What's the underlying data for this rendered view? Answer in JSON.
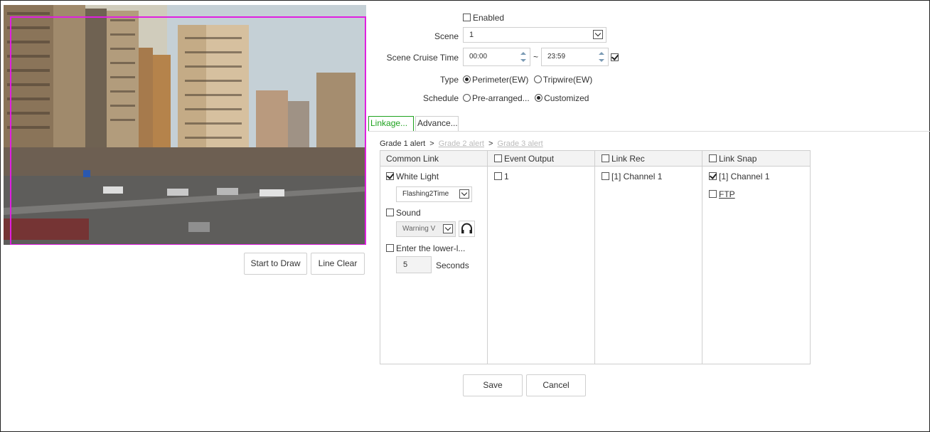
{
  "preview": {
    "start_draw_label": "Start to Draw",
    "line_clear_label": "Line Clear"
  },
  "form": {
    "enabled_label": "Enabled",
    "enabled_checked": false,
    "scene_label": "Scene",
    "scene_value": "1",
    "cruise_label": "Scene Cruise Time",
    "cruise_start": "00:00",
    "cruise_sep": "~",
    "cruise_end": "23:59",
    "cruise_checked": true,
    "type_label": "Type",
    "type_options": [
      "Perimeter(EW)",
      "Tripwire(EW)"
    ],
    "type_selected": "Perimeter(EW)",
    "schedule_label": "Schedule",
    "schedule_options": [
      "Pre-arranged...",
      "Customized"
    ],
    "schedule_selected": "Customized"
  },
  "tabs": [
    {
      "label": "Linkage...",
      "active": true
    },
    {
      "label": "Advance...",
      "active": false
    }
  ],
  "breadcrumb": {
    "grade1": "Grade 1 alert",
    "sep": ">",
    "grade2": "Grade 2 alert",
    "grade3": "Grade 3 alert"
  },
  "link_table": {
    "columns": [
      "Common Link",
      "Event Output",
      "Link Rec",
      "Link Snap"
    ],
    "common": {
      "white_light_label": "White Light",
      "white_light_checked": true,
      "white_light_mode": "Flashing2Time",
      "sound_label": "Sound",
      "sound_checked": false,
      "sound_value": "Warning V",
      "lower_label": "Enter the lower-l...",
      "lower_checked": false,
      "seconds_value": "5",
      "seconds_label": "Seconds"
    },
    "event_output": [
      {
        "label": "1",
        "checked": false
      }
    ],
    "link_rec": [
      {
        "label": "[1] Channel 1",
        "checked": false
      }
    ],
    "link_snap": [
      {
        "label": "[1] Channel 1",
        "checked": true
      },
      {
        "label": "FTP",
        "checked": false
      }
    ]
  },
  "actions": {
    "save_label": "Save",
    "cancel_label": "Cancel"
  },
  "colors": {
    "accent_green": "#1ea21e",
    "draw_magenta": "#e020e0"
  }
}
